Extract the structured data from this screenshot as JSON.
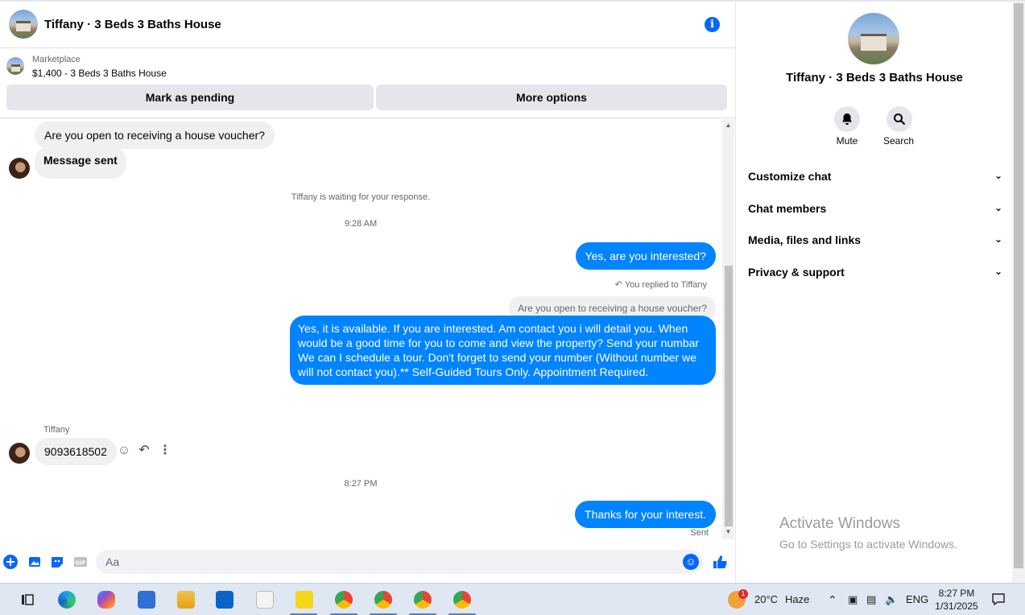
{
  "header": {
    "title": "Tiffany · 3 Beds 3 Baths House"
  },
  "listing": {
    "category": "Marketplace",
    "title": "$1,400 - 3 Beds 3 Baths House",
    "pending_label": "Mark as pending",
    "more_label": "More options"
  },
  "messages": {
    "m1": "Are you open to receiving a house voucher?",
    "m2": "Message sent",
    "waiting": "Tiffany is waiting for your response.",
    "time1": "9:28 AM",
    "m3": "Yes, are you interested?",
    "replied": "You replied to Tiffany",
    "quote": "Are you open to receiving a house voucher?",
    "m4": "Yes, it is available. If you are interested.  Am contact you i will detail you.  When would be a good time for you to come and view the property? Send your numbar We can I schedule a tour.  Don't forget to send your number (Without number we will not contact you).** Self-Guided Tours Only. Appointment Required.",
    "sender": "Tiffany",
    "m5": "9093618502",
    "time2": "8:27 PM",
    "m6": "Thanks for your interest.",
    "status": "Sent"
  },
  "composer": {
    "placeholder": "Aa"
  },
  "info": {
    "title": "Tiffany · 3 Beds 3 Baths House",
    "mute_label": "Mute",
    "search_label": "Search",
    "sections": [
      "Customize chat",
      "Chat members",
      "Media, files and links",
      "Privacy & support"
    ]
  },
  "watermark": {
    "line1": "Activate Windows",
    "line2": "Go to Settings to activate Windows."
  },
  "taskbar": {
    "weather_badge": "1",
    "weather": "20°C",
    "weather_desc": "Haze",
    "lang": "ENG",
    "time": "8:27 PM",
    "date": "1/31/2025"
  },
  "colors": {
    "accent": "#0866ff",
    "outgoing": "#0084ff",
    "incoming": "#f0f0f0"
  }
}
